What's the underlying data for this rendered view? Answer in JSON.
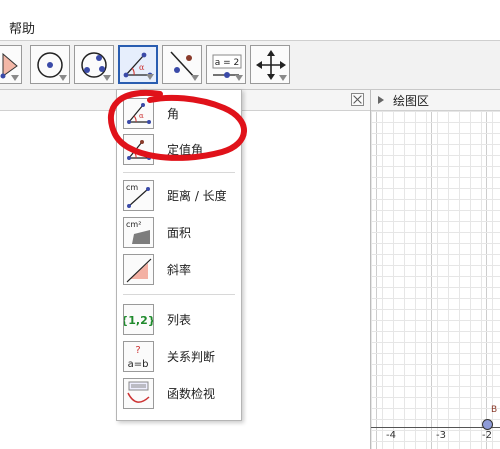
{
  "menubar": {
    "help": "帮助"
  },
  "toolbar": {
    "tools": [
      {
        "name": "polygon-tool-icon"
      },
      {
        "name": "circle-center-point-icon"
      },
      {
        "name": "circle-three-points-icon"
      },
      {
        "name": "angle-tool-icon",
        "active": true
      },
      {
        "name": "reflect-tool-icon"
      },
      {
        "name": "slider-tool-icon",
        "label": "a = 2"
      },
      {
        "name": "move-graphics-icon"
      }
    ]
  },
  "graphics": {
    "title": "绘图区",
    "x_ticks": [
      "-4",
      "-3",
      "-2"
    ],
    "point_label": "B"
  },
  "dropdown": {
    "items": [
      {
        "label": "角",
        "icon": "angle-icon"
      },
      {
        "label": "定值角",
        "icon": "angle-fixed-size-icon"
      },
      {
        "label": "距离 / 长度",
        "icon": "distance-length-icon",
        "icon_text": "cm"
      },
      {
        "label": "面积",
        "icon": "area-icon",
        "icon_text": "cm²"
      },
      {
        "label": "斜率",
        "icon": "slope-icon"
      },
      {
        "label": "列表",
        "icon": "list-icon",
        "icon_text": "{1,2}"
      },
      {
        "label": "关系判断",
        "icon": "relation-icon",
        "icon_text": "? a=b"
      },
      {
        "label": "函数检视",
        "icon": "function-inspector-icon"
      }
    ]
  },
  "colors": {
    "highlight_stroke": "#e0121a",
    "active_border": "#2a5db0"
  }
}
